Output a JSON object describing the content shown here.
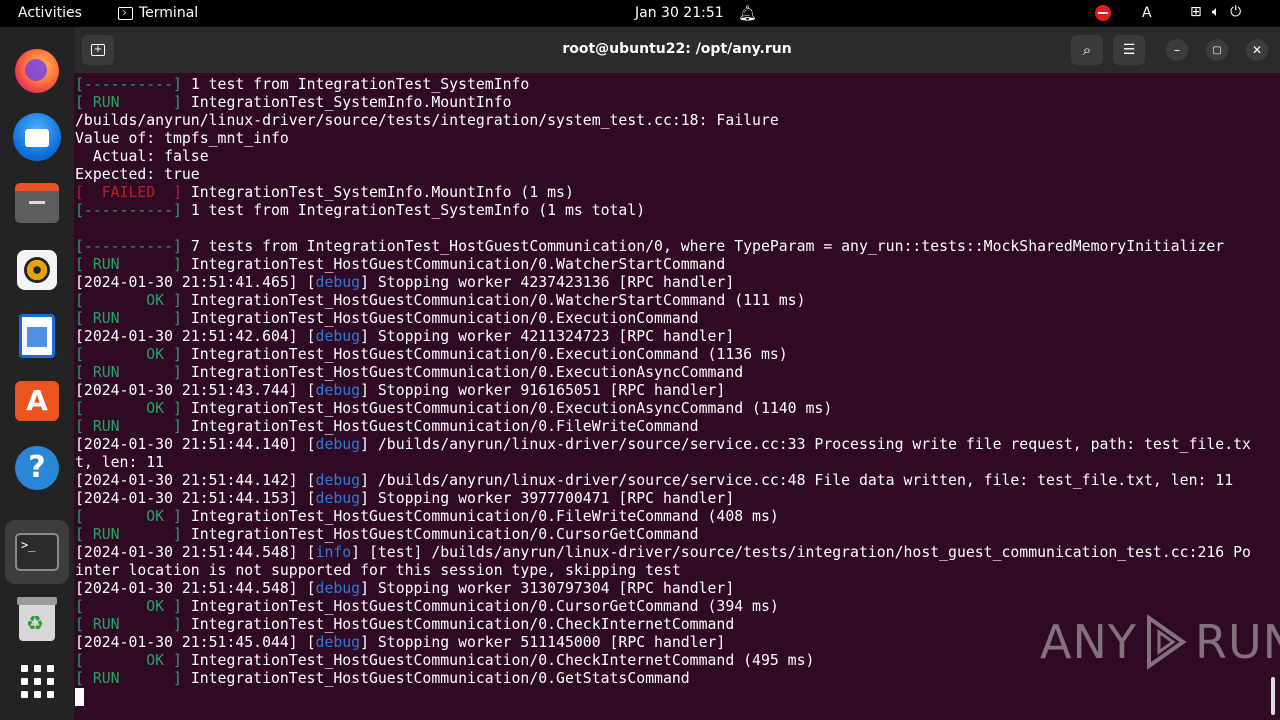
{
  "topbar": {
    "activities": "Activities",
    "app_name": "Terminal",
    "clock": "Jan 30  21:51",
    "language": "A"
  },
  "dock": {
    "items": [
      "firefox",
      "thunderbird",
      "files",
      "rhythmbox",
      "libreoffice-writer",
      "app-center",
      "help",
      "terminal",
      "trash",
      "show-apps"
    ]
  },
  "window": {
    "title": "root@ubuntu22: /opt/any.run"
  },
  "terminal": {
    "lines": [
      [
        {
          "t": "[----------] ",
          "c": "g"
        },
        {
          "t": "1 test from IntegrationTest_SystemInfo"
        }
      ],
      [
        {
          "t": "[ RUN      ] ",
          "c": "g"
        },
        {
          "t": "IntegrationTest_SystemInfo.MountInfo"
        }
      ],
      [
        {
          "t": "/builds/anyrun/linux-driver/source/tests/integration/system_test.cc:18: Failure"
        }
      ],
      [
        {
          "t": "Value of: tmpfs_mnt_info"
        }
      ],
      [
        {
          "t": "  Actual: false"
        }
      ],
      [
        {
          "t": "Expected: true"
        }
      ],
      [
        {
          "t": "[  FAILED  ] ",
          "c": "r"
        },
        {
          "t": "IntegrationTest_SystemInfo.MountInfo (1 ms)"
        }
      ],
      [
        {
          "t": "[----------] ",
          "c": "g"
        },
        {
          "t": "1 test from IntegrationTest_SystemInfo (1 ms total)"
        }
      ],
      [
        {
          "t": ""
        }
      ],
      [
        {
          "t": "[----------] ",
          "c": "g"
        },
        {
          "t": "7 tests from IntegrationTest_HostGuestCommunication/0, where TypeParam = any_run::tests::MockSharedMemoryInitializer"
        }
      ],
      [
        {
          "t": "[ RUN      ] ",
          "c": "g"
        },
        {
          "t": "IntegrationTest_HostGuestCommunication/0.WatcherStartCommand"
        }
      ],
      [
        {
          "t": "[2024-01-30 21:51:41.465] ["
        },
        {
          "t": "debug",
          "c": "b"
        },
        {
          "t": "] Stopping worker 4237423136 [RPC handler]"
        }
      ],
      [
        {
          "t": "[       OK ] ",
          "c": "g"
        },
        {
          "t": "IntegrationTest_HostGuestCommunication/0.WatcherStartCommand (111 ms)"
        }
      ],
      [
        {
          "t": "[ RUN      ] ",
          "c": "g"
        },
        {
          "t": "IntegrationTest_HostGuestCommunication/0.ExecutionCommand"
        }
      ],
      [
        {
          "t": "[2024-01-30 21:51:42.604] ["
        },
        {
          "t": "debug",
          "c": "b"
        },
        {
          "t": "] Stopping worker 4211324723 [RPC handler]"
        }
      ],
      [
        {
          "t": "[       OK ] ",
          "c": "g"
        },
        {
          "t": "IntegrationTest_HostGuestCommunication/0.ExecutionCommand (1136 ms)"
        }
      ],
      [
        {
          "t": "[ RUN      ] ",
          "c": "g"
        },
        {
          "t": "IntegrationTest_HostGuestCommunication/0.ExecutionAsyncCommand"
        }
      ],
      [
        {
          "t": "[2024-01-30 21:51:43.744] ["
        },
        {
          "t": "debug",
          "c": "b"
        },
        {
          "t": "] Stopping worker 916165051 [RPC handler]"
        }
      ],
      [
        {
          "t": "[       OK ] ",
          "c": "g"
        },
        {
          "t": "IntegrationTest_HostGuestCommunication/0.ExecutionAsyncCommand (1140 ms)"
        }
      ],
      [
        {
          "t": "[ RUN      ] ",
          "c": "g"
        },
        {
          "t": "IntegrationTest_HostGuestCommunication/0.FileWriteCommand"
        }
      ],
      [
        {
          "t": "[2024-01-30 21:51:44.140] ["
        },
        {
          "t": "debug",
          "c": "b"
        },
        {
          "t": "] /builds/anyrun/linux-driver/source/service.cc:33 Processing write file request, path: test_file.tx"
        }
      ],
      [
        {
          "t": "t, len: 11"
        }
      ],
      [
        {
          "t": "[2024-01-30 21:51:44.142] ["
        },
        {
          "t": "debug",
          "c": "b"
        },
        {
          "t": "] /builds/anyrun/linux-driver/source/service.cc:48 File data written, file: test_file.txt, len: 11"
        }
      ],
      [
        {
          "t": "[2024-01-30 21:51:44.153] ["
        },
        {
          "t": "debug",
          "c": "b"
        },
        {
          "t": "] Stopping worker 3977700471 [RPC handler]"
        }
      ],
      [
        {
          "t": "[       OK ] ",
          "c": "g"
        },
        {
          "t": "IntegrationTest_HostGuestCommunication/0.FileWriteCommand (408 ms)"
        }
      ],
      [
        {
          "t": "[ RUN      ] ",
          "c": "g"
        },
        {
          "t": "IntegrationTest_HostGuestCommunication/0.CursorGetCommand"
        }
      ],
      [
        {
          "t": "[2024-01-30 21:51:44.548] ["
        },
        {
          "t": "info",
          "c": "b"
        },
        {
          "t": "] [test] /builds/anyrun/linux-driver/source/tests/integration/host_guest_communication_test.cc:216 Po"
        }
      ],
      [
        {
          "t": "inter location is not supported for this session type, skipping test"
        }
      ],
      [
        {
          "t": "[2024-01-30 21:51:44.548] ["
        },
        {
          "t": "debug",
          "c": "b"
        },
        {
          "t": "] Stopping worker 3130797304 [RPC handler]"
        }
      ],
      [
        {
          "t": "[       OK ] ",
          "c": "g"
        },
        {
          "t": "IntegrationTest_HostGuestCommunication/0.CursorGetCommand (394 ms)"
        }
      ],
      [
        {
          "t": "[ RUN      ] ",
          "c": "g"
        },
        {
          "t": "IntegrationTest_HostGuestCommunication/0.CheckInternetCommand"
        }
      ],
      [
        {
          "t": "[2024-01-30 21:51:45.044] ["
        },
        {
          "t": "debug",
          "c": "b"
        },
        {
          "t": "] Stopping worker 511145000 [RPC handler]"
        }
      ],
      [
        {
          "t": "[       OK ] ",
          "c": "g"
        },
        {
          "t": "IntegrationTest_HostGuestCommunication/0.CheckInternetCommand (495 ms)"
        }
      ],
      [
        {
          "t": "[ RUN      ] ",
          "c": "g"
        },
        {
          "t": "IntegrationTest_HostGuestCommunication/0.GetStatsCommand"
        }
      ]
    ]
  },
  "watermark": {
    "left": "ANY",
    "right": "RUN"
  },
  "colors": {
    "terminal_bg": "#300a24",
    "green": "#26a269",
    "red": "#c01c28",
    "blue": "#2a7bde",
    "ubuntu_orange": "#e95420"
  }
}
